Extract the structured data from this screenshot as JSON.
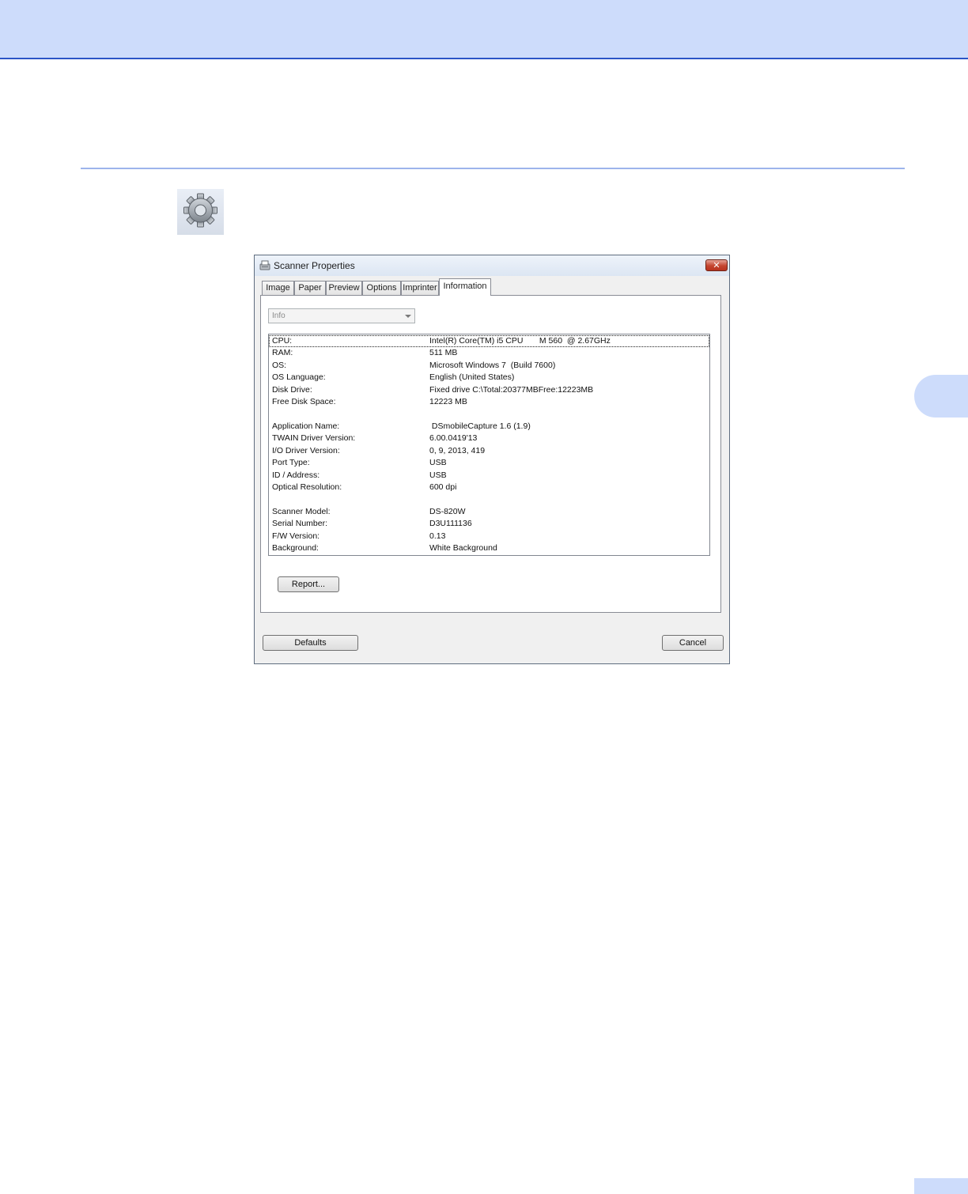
{
  "dialog": {
    "title": "Scanner Properties",
    "close_glyph": "✕",
    "tabs": [
      {
        "label": "Image"
      },
      {
        "label": "Paper"
      },
      {
        "label": "Preview"
      },
      {
        "label": "Options"
      },
      {
        "label": "Imprinter"
      },
      {
        "label": "Information",
        "active": true
      }
    ],
    "combo": {
      "value": "Info"
    },
    "info_rows": [
      {
        "label": "CPU:",
        "value": "Intel(R) Core(TM) i5 CPU       M 560  @ 2.67GHz"
      },
      {
        "label": "RAM:",
        "value": "511 MB"
      },
      {
        "label": "OS:",
        "value": "Microsoft Windows 7  (Build 7600)"
      },
      {
        "label": "OS Language:",
        "value": "English (United States)"
      },
      {
        "label": "Disk Drive:",
        "value": "Fixed drive C:\\Total:20377MBFree:12223MB"
      },
      {
        "label": "Free Disk Space:",
        "value": "12223 MB"
      },
      {
        "label": "Application Name:",
        "value": " DSmobileCapture 1.6 (1.9)"
      },
      {
        "label": "TWAIN Driver Version:",
        "value": "6.00.0419'13"
      },
      {
        "label": "I/O Driver Version:",
        "value": "0, 9, 2013, 419"
      },
      {
        "label": "Port Type:",
        "value": "USB"
      },
      {
        "label": "ID / Address:",
        "value": "USB"
      },
      {
        "label": "Optical Resolution:",
        "value": "600 dpi"
      },
      {
        "label": "Scanner Model:",
        "value": "DS-820W"
      },
      {
        "label": "Serial Number:",
        "value": "D3U111136"
      },
      {
        "label": "F/W Version:",
        "value": "0.13"
      },
      {
        "label": "Background:",
        "value": "White Background"
      }
    ],
    "buttons": {
      "report": "Report...",
      "defaults": "Defaults",
      "cancel": "Cancel"
    }
  },
  "icons": {
    "settings": "gear-icon",
    "title": "scanner-icon"
  },
  "colors": {
    "header_band": "#cddcfb",
    "header_line": "#2b55c6",
    "section_rule": "#9db4ec"
  }
}
